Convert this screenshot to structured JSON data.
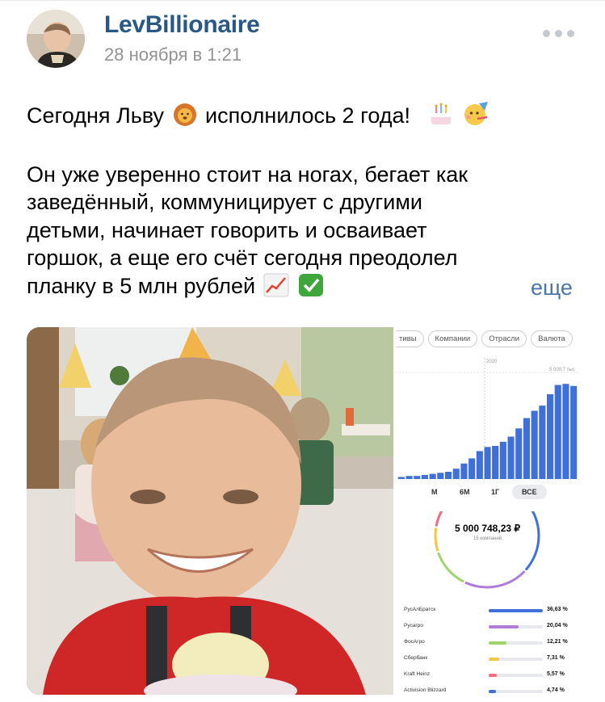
{
  "post": {
    "author": "LevBillionaire",
    "date": "28 ноября в 1:21",
    "paragraph1": "Сегодня Льву",
    "paragraph1_mid": "исполнилось 2 года!",
    "lines": [
      "Он уже уверенно стоит на ногах, бегает как",
      "заведённый, коммуницирует с другими",
      "детьми, начинает говорить и осваивает",
      "горшок, а еще его счёт сегодня преодолел",
      "планку в 5 млн рублей"
    ],
    "read_more": "еще",
    "icons": [
      "more-dots-icon",
      "lion-emoji-icon",
      "cake-emoji-icon",
      "party-face-emoji-icon",
      "chart-up-emoji-icon",
      "check-mark-emoji-icon"
    ]
  },
  "screenshot_top": {
    "chips": [
      "тивы",
      "Компании",
      "Отрасли",
      "Валюта"
    ],
    "periods": [
      "М",
      "6М",
      "1Г",
      "ВСЕ"
    ],
    "active_period": "ВСЕ",
    "year_marker": "2020",
    "target_label": "5 000,7 тыс"
  },
  "chart_data": {
    "type": "bar",
    "title": "",
    "xlabel": "",
    "ylabel": "",
    "annotations": [
      "2020",
      "5 000,7 тыс"
    ],
    "values": [
      0.02,
      0.03,
      0.03,
      0.04,
      0.05,
      0.06,
      0.07,
      0.1,
      0.15,
      0.2,
      0.27,
      0.31,
      0.32,
      0.36,
      0.41,
      0.49,
      0.59,
      0.66,
      0.71,
      0.82,
      0.91,
      0.92,
      0.9
    ]
  },
  "screenshot_bottom": {
    "total": "5 000 748,23 ₽",
    "subtotal": "15 компаний",
    "allocations": [
      {
        "name": "РусАлБратск",
        "pct": "36,63 %",
        "share": 1.0,
        "color": "#3f6fd8"
      },
      {
        "name": "Русагро",
        "pct": "20,04 %",
        "share": 0.55,
        "color": "#b07cd6"
      },
      {
        "name": "ФосАгро",
        "pct": "12,21 %",
        "share": 0.33,
        "color": "#9fd36c"
      },
      {
        "name": "Сбербанк",
        "pct": "7,31 %",
        "share": 0.2,
        "color": "#f2c744"
      },
      {
        "name": "Kraft Heinz",
        "pct": "5,57 %",
        "share": 0.15,
        "color": "#f06b7e"
      },
      {
        "name": "Activision Blizzard",
        "pct": "4,74 %",
        "share": 0.13,
        "color": "#3f6fd8"
      }
    ]
  }
}
